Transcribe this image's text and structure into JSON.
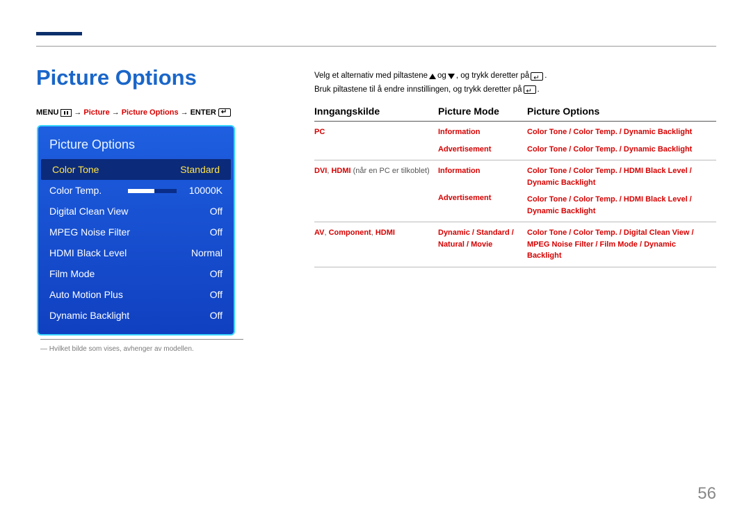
{
  "page": {
    "title": "Picture Options",
    "number": "56"
  },
  "breadcrumb": {
    "menu": "MENU",
    "arrow": "→",
    "seg1": "Picture",
    "seg2": "Picture Options",
    "enter": "ENTER"
  },
  "osd": {
    "title": "Picture Options",
    "rows": [
      {
        "label": "Color Tone",
        "value": "Standard",
        "selected": true
      },
      {
        "label": "Color Temp.",
        "value": "10000K",
        "slider": true
      },
      {
        "label": "Digital Clean View",
        "value": "Off"
      },
      {
        "label": "MPEG Noise Filter",
        "value": "Off"
      },
      {
        "label": "HDMI Black Level",
        "value": "Normal"
      },
      {
        "label": "Film Mode",
        "value": "Off"
      },
      {
        "label": "Auto Motion Plus",
        "value": "Off"
      },
      {
        "label": "Dynamic Backlight",
        "value": "Off"
      }
    ]
  },
  "footnote": "― Hvilket bilde som vises, avhenger av modellen.",
  "intro": {
    "l1a": "Velg et alternativ med piltastene ",
    "l1b": " og ",
    "l1c": ", og trykk deretter på ",
    "l1d": ".",
    "l2a": "Bruk piltastene til å endre innstillingen, og trykk deretter på ",
    "l2b": "."
  },
  "table": {
    "headers": {
      "h1": "Inngangskilde",
      "h2": "Picture Mode",
      "h3": "Picture Options"
    },
    "r1": {
      "src_red": "PC",
      "mode1": "Information",
      "opt1": "Color Tone / Color Temp. / Dynamic Backlight",
      "mode2": "Advertisement",
      "opt2": "Color Tone / Color Temp. / Dynamic Backlight"
    },
    "r2": {
      "src_red": "DVI",
      "src_sep": ", ",
      "src_red2": "HDMI",
      "src_plain": " (når en PC er tilkoblet)",
      "mode1": "Information",
      "opt1a": "Color Tone / Color Temp. / HDMI Black Level / Dynamic Backlight",
      "mode2": "Advertisement",
      "opt2a": "Color Tone / Color Temp. / HDMI Black Level / Dynamic Backlight"
    },
    "r3": {
      "src_red1": "AV",
      "src_sep1": ", ",
      "src_red2": "Component",
      "src_sep2": ", ",
      "src_red3": "HDMI",
      "mode": "Dynamic / Standard / Natural / Movie",
      "opt": "Color Tone / Color Temp. / Digital Clean View / MPEG Noise Filter / Film Mode / Dynamic Backlight"
    }
  }
}
